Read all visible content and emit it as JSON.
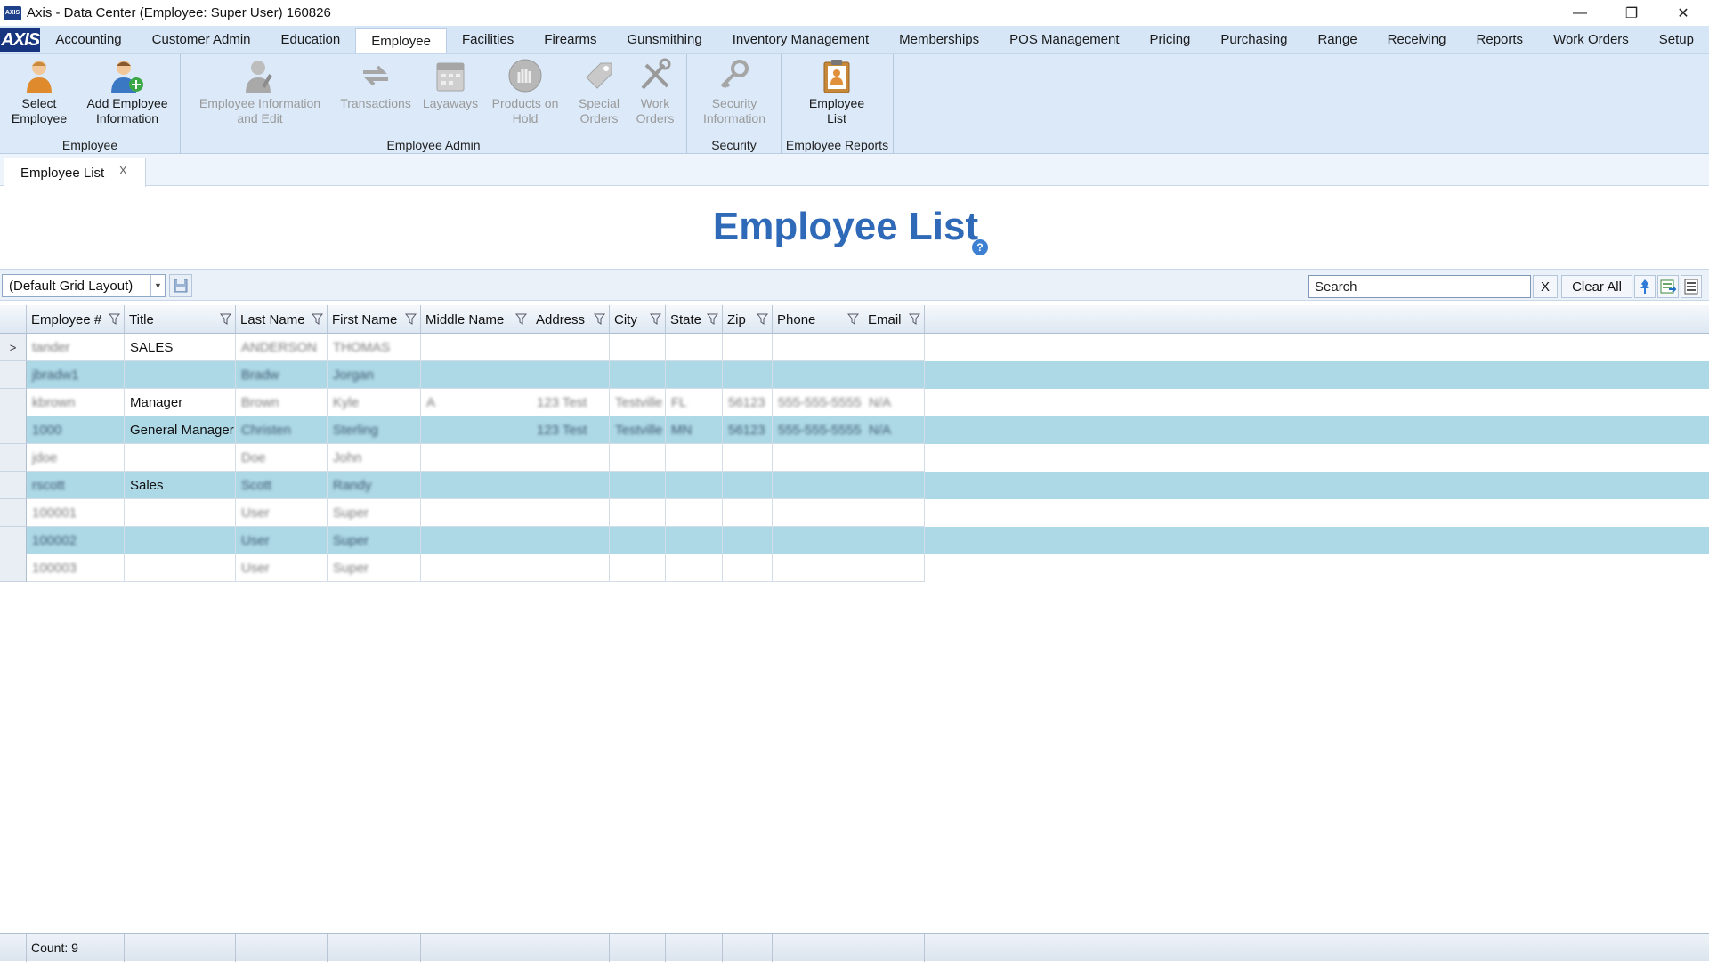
{
  "window": {
    "title": "Axis - Data Center  (Employee: Super User) 160826",
    "app_icon": "AXIS",
    "minimize": "—",
    "restore": "❐",
    "close": "✕"
  },
  "menubar": {
    "logo": "AXIS",
    "items": [
      "Accounting",
      "Customer Admin",
      "Education",
      "Employee",
      "Facilities",
      "Firearms",
      "Gunsmithing",
      "Inventory Management",
      "Memberships",
      "POS Management",
      "Pricing",
      "Purchasing",
      "Range",
      "Receiving",
      "Reports",
      "Work Orders",
      "Setup"
    ],
    "active": "Employee"
  },
  "ribbon": {
    "groups": [
      {
        "label": "Employee",
        "buttons": [
          {
            "line1": "Select",
            "line2": "Employee",
            "icon": "person-icon",
            "enabled": true
          },
          {
            "line1": "Add Employee",
            "line2": "Information",
            "icon": "add-person-icon",
            "enabled": true
          }
        ]
      },
      {
        "label": "Employee Admin",
        "buttons": [
          {
            "line1": "Employee Information",
            "line2": "and Edit",
            "icon": "person-edit-icon",
            "enabled": false
          },
          {
            "line1": "Transactions",
            "line2": "",
            "icon": "transactions-icon",
            "enabled": false
          },
          {
            "line1": "Layaways",
            "line2": "",
            "icon": "calendar-icon",
            "enabled": false
          },
          {
            "line1": "Products on",
            "line2": "Hold",
            "icon": "hand-stop-icon",
            "enabled": false
          },
          {
            "line1": "Special",
            "line2": "Orders",
            "icon": "tag-icon",
            "enabled": false
          },
          {
            "line1": "Work",
            "line2": "Orders",
            "icon": "tools-icon",
            "enabled": false
          }
        ]
      },
      {
        "label": "Security",
        "buttons": [
          {
            "line1": "Security",
            "line2": "Information",
            "icon": "key-icon",
            "enabled": false
          }
        ]
      },
      {
        "label": "Employee Reports",
        "buttons": [
          {
            "line1": "Employee",
            "line2": "List",
            "icon": "clipboard-icon",
            "enabled": true
          }
        ]
      }
    ]
  },
  "doc_tab": {
    "label": "Employee List",
    "close": "X"
  },
  "page": {
    "title": "Employee List",
    "help": "?"
  },
  "toolbar": {
    "layout": "(Default Grid Layout)",
    "search_value": "Search",
    "clear_x": "X",
    "clear_all": "Clear All"
  },
  "grid": {
    "columns": [
      "Employee #",
      "Title",
      "Last Name",
      "First Name",
      "Middle Name",
      "Address",
      "City",
      "State",
      "Zip",
      "Phone",
      "Email"
    ],
    "rows": [
      {
        "employee": "tander",
        "title": "SALES",
        "last": "ANDERSON",
        "first": "THOMAS",
        "middle": "",
        "address": "",
        "city": "",
        "state": "",
        "zip": "",
        "phone": "",
        "email": "",
        "current": true
      },
      {
        "employee": "jbradw1",
        "title": "",
        "last": "Bradw",
        "first": "Jorgan",
        "middle": "",
        "address": "",
        "city": "",
        "state": "",
        "zip": "",
        "phone": "",
        "email": ""
      },
      {
        "employee": "kbrown",
        "title": "Manager",
        "last": "Brown",
        "first": "Kyle",
        "middle": "A",
        "address": "123 Test",
        "city": "Testville",
        "state": "FL",
        "zip": "56123",
        "phone": "555-555-5555",
        "email": "N/A"
      },
      {
        "employee": "1000",
        "title": "General Manager",
        "last": "Christen",
        "first": "Sterling",
        "middle": "",
        "address": "123 Test",
        "city": "Testville",
        "state": "MN",
        "zip": "56123",
        "phone": "555-555-5555",
        "email": "N/A"
      },
      {
        "employee": "jdoe",
        "title": "",
        "last": "Doe",
        "first": "John",
        "middle": "",
        "address": "",
        "city": "",
        "state": "",
        "zip": "",
        "phone": "",
        "email": ""
      },
      {
        "employee": "rscott",
        "title": "Sales",
        "last": "Scott",
        "first": "Randy",
        "middle": "",
        "address": "",
        "city": "",
        "state": "",
        "zip": "",
        "phone": "",
        "email": ""
      },
      {
        "employee": "100001",
        "title": "",
        "last": "User",
        "first": "Super",
        "middle": "",
        "address": "",
        "city": "",
        "state": "",
        "zip": "",
        "phone": "",
        "email": ""
      },
      {
        "employee": "100002",
        "title": "",
        "last": "User",
        "first": "Super",
        "middle": "",
        "address": "",
        "city": "",
        "state": "",
        "zip": "",
        "phone": "",
        "email": ""
      },
      {
        "employee": "100003",
        "title": "",
        "last": "User",
        "first": "Super",
        "middle": "",
        "address": "",
        "city": "",
        "state": "",
        "zip": "",
        "phone": "",
        "email": ""
      }
    ],
    "current_row_marker": ">",
    "alt_row_color": "#add8e6"
  },
  "footer": {
    "count": "Count: 9"
  }
}
